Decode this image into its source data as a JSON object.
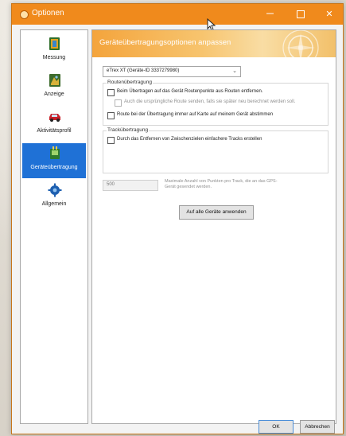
{
  "window": {
    "title": "Optionen",
    "close_glyph": "✕"
  },
  "sidebar": {
    "items": [
      {
        "label": "Messung",
        "icon": "measurement-book-icon",
        "active": false
      },
      {
        "label": "Anzeige",
        "icon": "display-icon",
        "active": false
      },
      {
        "label": "Aktivitätsprofil",
        "icon": "car-activity-icon",
        "active": false
      },
      {
        "label": "Geräteübertragung",
        "icon": "device-transfer-icon",
        "active": true
      },
      {
        "label": "Allgemein",
        "icon": "gear-icon",
        "active": false
      }
    ]
  },
  "content": {
    "banner_title": "Geräteübertragungsoptionen anpassen",
    "device_select": "eTrex XT (Geräte-ID 3337279980)",
    "route_group": {
      "title": "Routenübertragung",
      "remove_route_points": {
        "label": "Beim Übertragen auf das Gerät Routenpunkte aus Routen entfernen.",
        "checked": false
      },
      "send_original_route": {
        "label": "Auch die ursprüngliche Route senden, falls sie später neu berechnet werden soll.",
        "checked": false,
        "disabled": true
      },
      "match_map": {
        "label": "Route bei der Übertragung immer auf Karte auf meinem Gerät abstimmen",
        "checked": false
      }
    },
    "track_group": {
      "title": "Trackübertragung",
      "simplify_tracks": {
        "label": "Durch das Entfernen von Zwischenzielen einfachere Tracks erstellen",
        "checked": false
      },
      "max_points_value": "500",
      "max_points_desc": "Maximale Anzahl von Punkten pro Track, die an das GPS-Gerät gesendet werden."
    },
    "apply_all_label": "Auf alle Geräte anwenden"
  },
  "footer": {
    "ok_label": "OK",
    "cancel_label": "Abbrechen"
  },
  "colors": {
    "titlebar": "#f08a1c",
    "accent_selected": "#1f71d6",
    "banner": "#f4a43c"
  }
}
